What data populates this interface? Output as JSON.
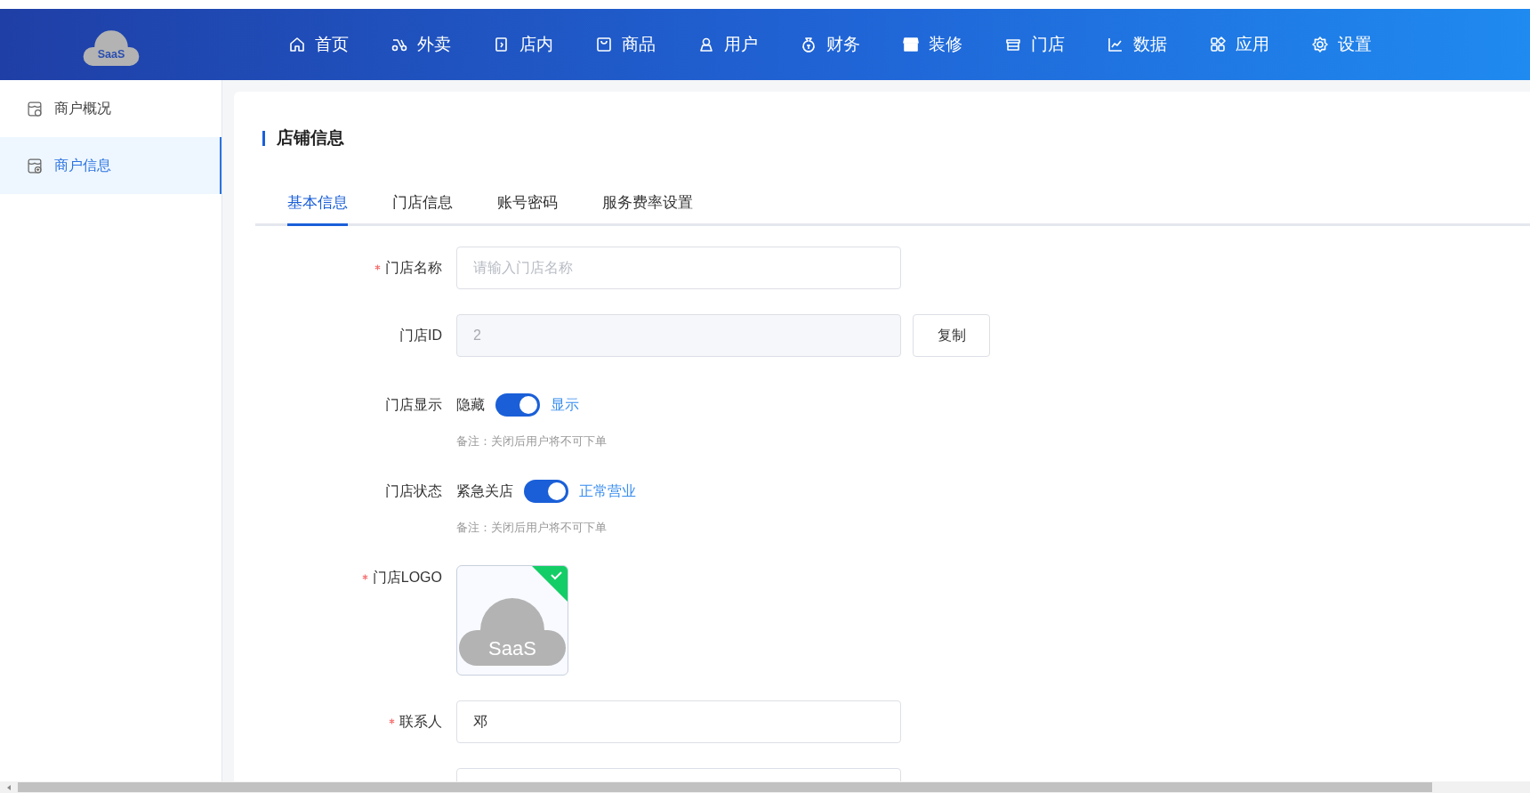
{
  "header": {
    "logo_text": "SaaS",
    "nav": [
      {
        "label": "首页",
        "selected": false
      },
      {
        "label": "外卖",
        "selected": false
      },
      {
        "label": "店内",
        "selected": false
      },
      {
        "label": "商品",
        "selected": false
      },
      {
        "label": "用户",
        "selected": false
      },
      {
        "label": "财务",
        "selected": false
      },
      {
        "label": "装修",
        "selected": false
      },
      {
        "label": "门店",
        "selected": false
      },
      {
        "label": "数据",
        "selected": false
      },
      {
        "label": "应用",
        "selected": false
      },
      {
        "label": "设置",
        "selected": false
      }
    ]
  },
  "sidebar": {
    "items": [
      {
        "label": "商户概况",
        "selected": false
      },
      {
        "label": "商户信息",
        "selected": true
      }
    ]
  },
  "card": {
    "title": "店铺信息",
    "tabs": [
      {
        "label": "基本信息",
        "selected": true
      },
      {
        "label": "门店信息",
        "selected": false
      },
      {
        "label": "账号密码",
        "selected": false
      },
      {
        "label": "服务费率设置",
        "selected": false
      }
    ],
    "fields": [
      {
        "kind": "input",
        "label": "门店名称",
        "required": true,
        "placeholder": "请输入门店名称"
      },
      {
        "kind": "readonly",
        "label": "门店ID",
        "required": false,
        "value": "2",
        "button": "复制"
      },
      {
        "kind": "switch",
        "label": "门店显示",
        "required": false,
        "off_text": "隐藏",
        "on_text": "显示",
        "on": true,
        "note": "备注：关闭后用户将不可下单"
      },
      {
        "kind": "switch",
        "label": "门店状态",
        "required": false,
        "off_text": "紧急关店",
        "on_text": "正常营业",
        "on": true,
        "note": "备注：关闭后用户将不可下单"
      },
      {
        "kind": "upload",
        "label": "门店LOGO",
        "required": true,
        "logo_text": "SaaS",
        "uploaded": true
      },
      {
        "kind": "input",
        "label": "联系人",
        "required": true,
        "value": "邓"
      },
      {
        "kind": "input"
      }
    ]
  }
}
